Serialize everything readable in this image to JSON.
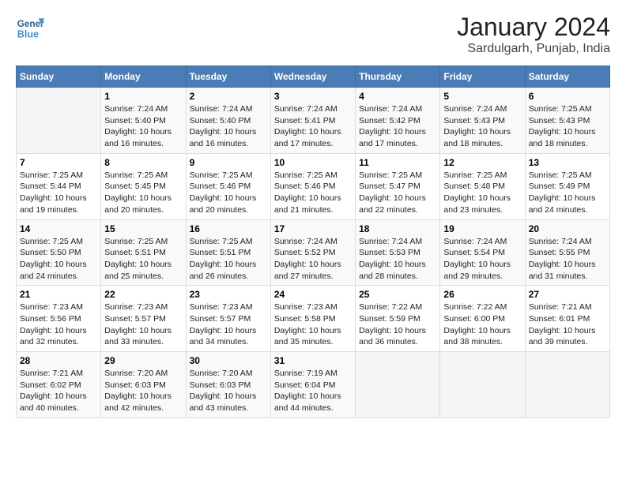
{
  "logo": {
    "line1": "General",
    "line2": "Blue"
  },
  "title": "January 2024",
  "subtitle": "Sardulgarh, Punjab, India",
  "days_of_week": [
    "Sunday",
    "Monday",
    "Tuesday",
    "Wednesday",
    "Thursday",
    "Friday",
    "Saturday"
  ],
  "weeks": [
    [
      {
        "day": "",
        "content": ""
      },
      {
        "day": "1",
        "content": "Sunrise: 7:24 AM\nSunset: 5:40 PM\nDaylight: 10 hours\nand 16 minutes."
      },
      {
        "day": "2",
        "content": "Sunrise: 7:24 AM\nSunset: 5:40 PM\nDaylight: 10 hours\nand 16 minutes."
      },
      {
        "day": "3",
        "content": "Sunrise: 7:24 AM\nSunset: 5:41 PM\nDaylight: 10 hours\nand 17 minutes."
      },
      {
        "day": "4",
        "content": "Sunrise: 7:24 AM\nSunset: 5:42 PM\nDaylight: 10 hours\nand 17 minutes."
      },
      {
        "day": "5",
        "content": "Sunrise: 7:24 AM\nSunset: 5:43 PM\nDaylight: 10 hours\nand 18 minutes."
      },
      {
        "day": "6",
        "content": "Sunrise: 7:25 AM\nSunset: 5:43 PM\nDaylight: 10 hours\nand 18 minutes."
      }
    ],
    [
      {
        "day": "7",
        "content": "Sunrise: 7:25 AM\nSunset: 5:44 PM\nDaylight: 10 hours\nand 19 minutes."
      },
      {
        "day": "8",
        "content": "Sunrise: 7:25 AM\nSunset: 5:45 PM\nDaylight: 10 hours\nand 20 minutes."
      },
      {
        "day": "9",
        "content": "Sunrise: 7:25 AM\nSunset: 5:46 PM\nDaylight: 10 hours\nand 20 minutes."
      },
      {
        "day": "10",
        "content": "Sunrise: 7:25 AM\nSunset: 5:46 PM\nDaylight: 10 hours\nand 21 minutes."
      },
      {
        "day": "11",
        "content": "Sunrise: 7:25 AM\nSunset: 5:47 PM\nDaylight: 10 hours\nand 22 minutes."
      },
      {
        "day": "12",
        "content": "Sunrise: 7:25 AM\nSunset: 5:48 PM\nDaylight: 10 hours\nand 23 minutes."
      },
      {
        "day": "13",
        "content": "Sunrise: 7:25 AM\nSunset: 5:49 PM\nDaylight: 10 hours\nand 24 minutes."
      }
    ],
    [
      {
        "day": "14",
        "content": "Sunrise: 7:25 AM\nSunset: 5:50 PM\nDaylight: 10 hours\nand 24 minutes."
      },
      {
        "day": "15",
        "content": "Sunrise: 7:25 AM\nSunset: 5:51 PM\nDaylight: 10 hours\nand 25 minutes."
      },
      {
        "day": "16",
        "content": "Sunrise: 7:25 AM\nSunset: 5:51 PM\nDaylight: 10 hours\nand 26 minutes."
      },
      {
        "day": "17",
        "content": "Sunrise: 7:24 AM\nSunset: 5:52 PM\nDaylight: 10 hours\nand 27 minutes."
      },
      {
        "day": "18",
        "content": "Sunrise: 7:24 AM\nSunset: 5:53 PM\nDaylight: 10 hours\nand 28 minutes."
      },
      {
        "day": "19",
        "content": "Sunrise: 7:24 AM\nSunset: 5:54 PM\nDaylight: 10 hours\nand 29 minutes."
      },
      {
        "day": "20",
        "content": "Sunrise: 7:24 AM\nSunset: 5:55 PM\nDaylight: 10 hours\nand 31 minutes."
      }
    ],
    [
      {
        "day": "21",
        "content": "Sunrise: 7:23 AM\nSunset: 5:56 PM\nDaylight: 10 hours\nand 32 minutes."
      },
      {
        "day": "22",
        "content": "Sunrise: 7:23 AM\nSunset: 5:57 PM\nDaylight: 10 hours\nand 33 minutes."
      },
      {
        "day": "23",
        "content": "Sunrise: 7:23 AM\nSunset: 5:57 PM\nDaylight: 10 hours\nand 34 minutes."
      },
      {
        "day": "24",
        "content": "Sunrise: 7:23 AM\nSunset: 5:58 PM\nDaylight: 10 hours\nand 35 minutes."
      },
      {
        "day": "25",
        "content": "Sunrise: 7:22 AM\nSunset: 5:59 PM\nDaylight: 10 hours\nand 36 minutes."
      },
      {
        "day": "26",
        "content": "Sunrise: 7:22 AM\nSunset: 6:00 PM\nDaylight: 10 hours\nand 38 minutes."
      },
      {
        "day": "27",
        "content": "Sunrise: 7:21 AM\nSunset: 6:01 PM\nDaylight: 10 hours\nand 39 minutes."
      }
    ],
    [
      {
        "day": "28",
        "content": "Sunrise: 7:21 AM\nSunset: 6:02 PM\nDaylight: 10 hours\nand 40 minutes."
      },
      {
        "day": "29",
        "content": "Sunrise: 7:20 AM\nSunset: 6:03 PM\nDaylight: 10 hours\nand 42 minutes."
      },
      {
        "day": "30",
        "content": "Sunrise: 7:20 AM\nSunset: 6:03 PM\nDaylight: 10 hours\nand 43 minutes."
      },
      {
        "day": "31",
        "content": "Sunrise: 7:19 AM\nSunset: 6:04 PM\nDaylight: 10 hours\nand 44 minutes."
      },
      {
        "day": "",
        "content": ""
      },
      {
        "day": "",
        "content": ""
      },
      {
        "day": "",
        "content": ""
      }
    ]
  ],
  "colors": {
    "header_bg": "#4a7db5",
    "header_text": "#ffffff",
    "title_color": "#222222",
    "subtitle_color": "#444444"
  }
}
